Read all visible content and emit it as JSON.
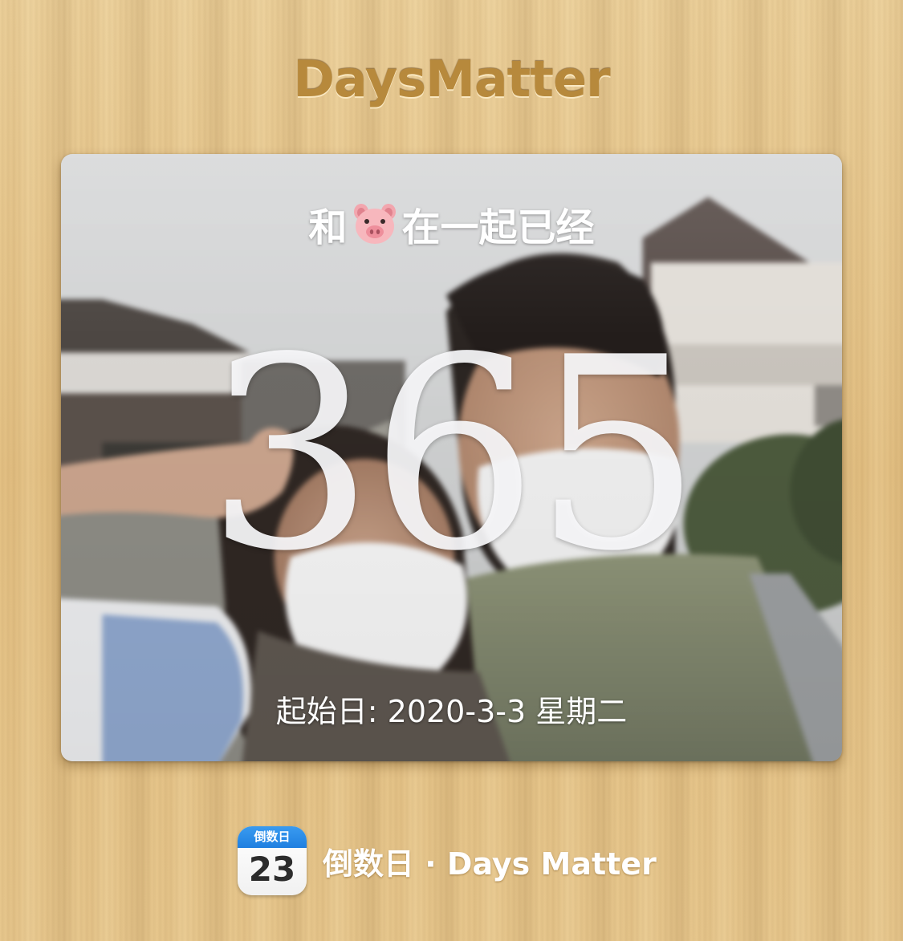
{
  "app": {
    "brand": "DaysMatter"
  },
  "card": {
    "title_before": "和",
    "title_emoji": "pig-face-icon",
    "title_after": "在一起已经",
    "count": "365",
    "start_date": "起始日: 2020-3-3 星期二"
  },
  "footer": {
    "calendar_icon_label": "倒数日",
    "calendar_icon_day": "23",
    "text": "倒数日 · Days Matter"
  },
  "colors": {
    "wood_background": "#e6c589",
    "brand_text": "#b7893c",
    "calendar_header": "#2a8ae8",
    "card_text": "#ffffff"
  }
}
